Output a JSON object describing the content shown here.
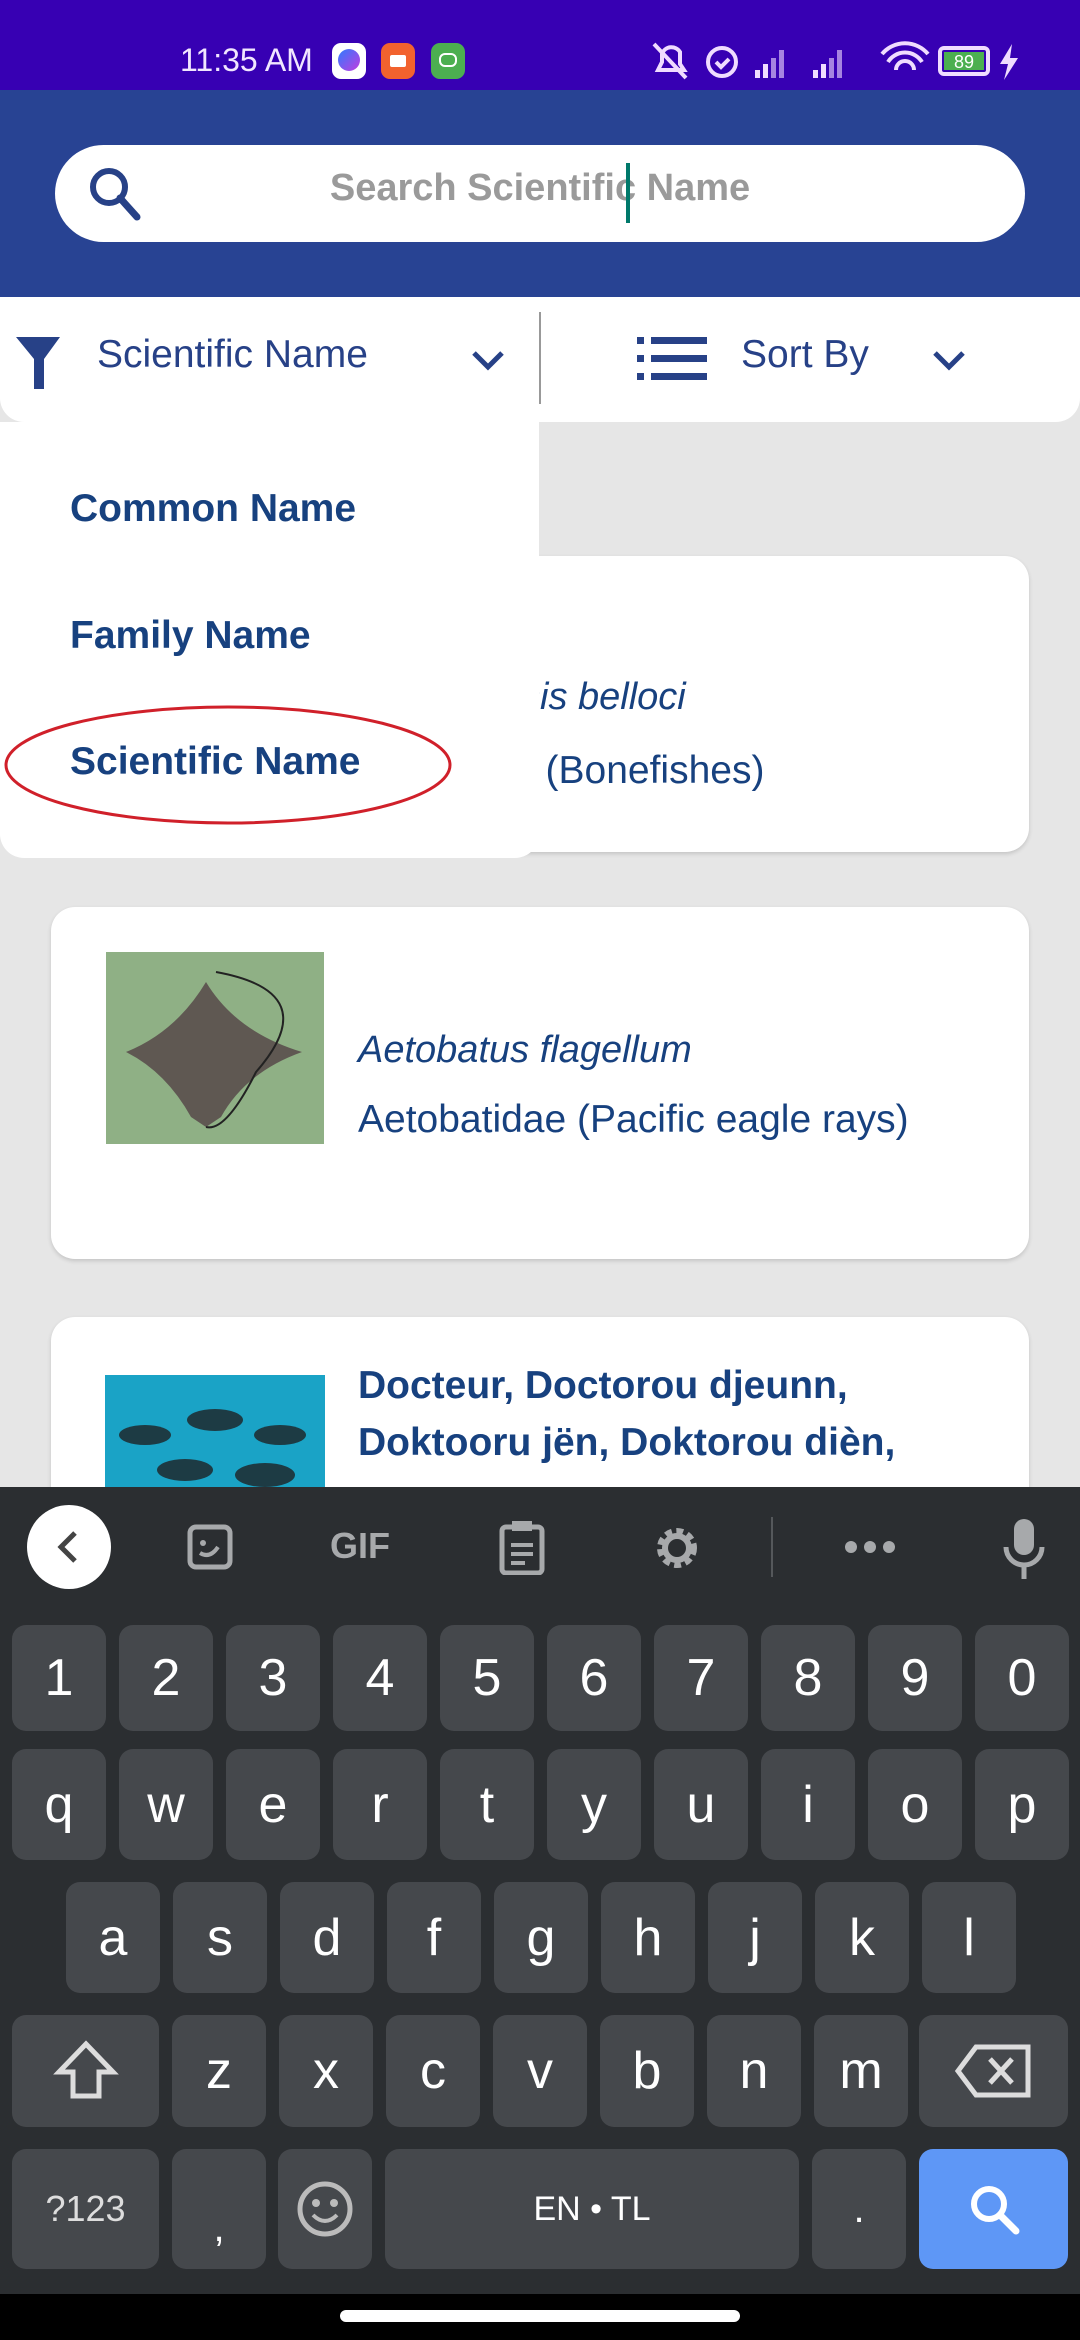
{
  "status_bar": {
    "time": "11:35 AM",
    "battery": "89",
    "app_icons": [
      "messenger-icon",
      "video-call-icon",
      "android-bot-icon"
    ],
    "system_icons": [
      "bell-off-icon",
      "alarm-icon",
      "signal-icon",
      "signal-icon",
      "wifi-icon",
      "battery-icon",
      "charging-icon"
    ]
  },
  "search": {
    "placeholder": "Search Scientific Name",
    "value": ""
  },
  "filter": {
    "selected": "Scientific Name",
    "sort_label": "Sort By"
  },
  "dropdown": {
    "options": [
      "Common Name",
      "Family Name",
      "Scientific Name"
    ],
    "highlighted": "Scientific Name"
  },
  "cards": [
    {
      "scientific_fragment": "sis belloci",
      "family_fragment": "e (Bonefishes)"
    },
    {
      "scientific": "Aetobatus flagellum",
      "family": "Aetobatidae (Pacific eagle rays)"
    },
    {
      "common": "Docteur, Doctorou djeunn, Doktooru jën, Doktorou dièn,"
    }
  ],
  "keyboard": {
    "toolbar": [
      "back",
      "sticker",
      "GIF",
      "clipboard",
      "settings",
      "more",
      "mic"
    ],
    "gif": "GIF",
    "row_numbers": [
      "1",
      "2",
      "3",
      "4",
      "5",
      "6",
      "7",
      "8",
      "9",
      "0"
    ],
    "row1": [
      "q",
      "w",
      "e",
      "r",
      "t",
      "y",
      "u",
      "i",
      "o",
      "p"
    ],
    "row2": [
      "a",
      "s",
      "d",
      "f",
      "g",
      "h",
      "j",
      "k",
      "l"
    ],
    "row3": [
      "z",
      "x",
      "c",
      "v",
      "b",
      "n",
      "m"
    ],
    "symbols": "?123",
    "comma": ",",
    "space": "EN • TL",
    "period": "."
  },
  "colors": {
    "status_bar": "#3700b3",
    "header": "#284393",
    "text": "#17417f",
    "keyboard": "#2b2e31",
    "key": "#45484c",
    "action_key": "#5e97f6",
    "annotation": "#d0202a"
  }
}
